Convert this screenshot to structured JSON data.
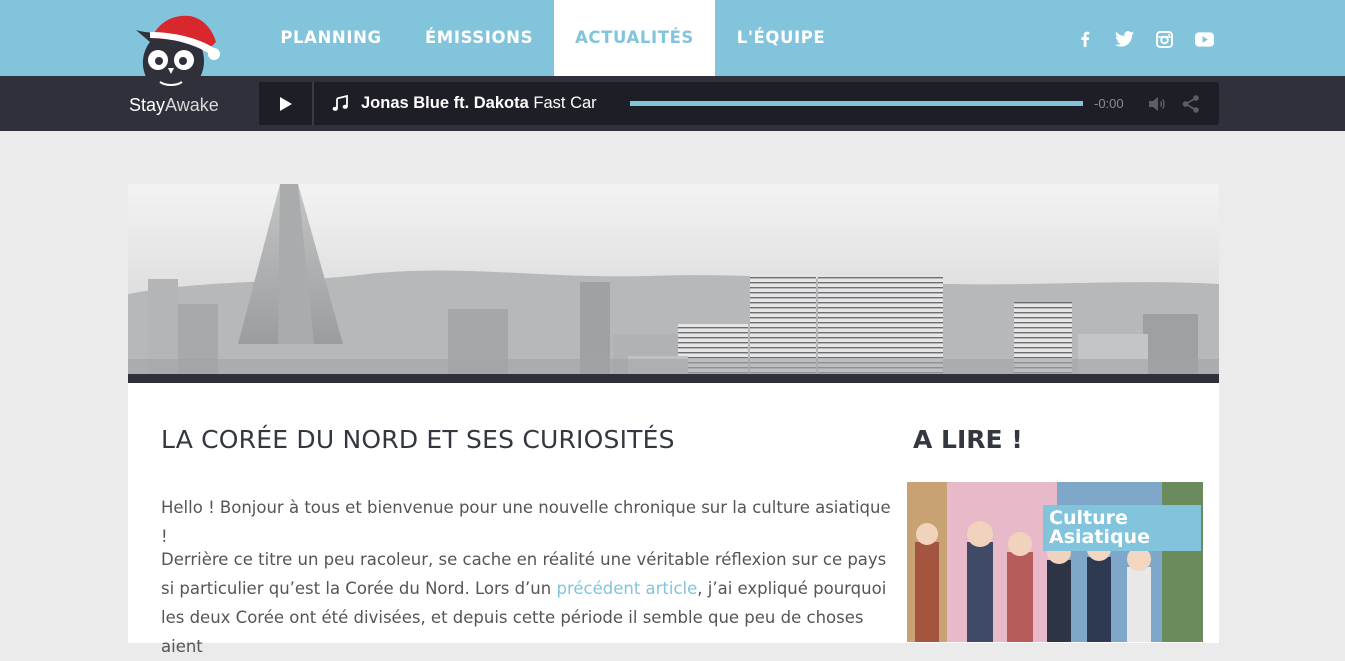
{
  "nav": {
    "items": [
      {
        "label": "PLANNING",
        "active": false
      },
      {
        "label": "ÉMISSIONS",
        "active": false
      },
      {
        "label": "ACTUALITÉS",
        "active": true
      },
      {
        "label": "L'ÉQUIPE",
        "active": false
      }
    ],
    "social": [
      "facebook-icon",
      "twitter-icon",
      "instagram-icon",
      "youtube-icon"
    ]
  },
  "logo": {
    "stay": "Stay",
    "awake": "Awake"
  },
  "player": {
    "artist": "Jonas Blue ft. Dakota",
    "title": "Fast Car",
    "time": "-0:00",
    "progress": 1.0
  },
  "article": {
    "title": "LA CORÉE DU NORD ET SES CURIOSITÉS",
    "p1": "Hello ! Bonjour à tous et bienvenue pour une nouvelle chronique sur la culture asiatique !",
    "p2_before": "Derrière ce titre un peu racoleur, se cache en réalité une véritable réflexion sur ce pays si particulier qu’est la Corée du Nord. Lors d’un ",
    "p2_link": "précédent article",
    "p2_after": ", j’ai expliqué pourquoi les deux Corée ont été divisées, et depuis cette période il semble que peu de choses aient"
  },
  "sidebar": {
    "title": "A LIRE !",
    "card_label": "Culture Asiatique"
  },
  "colors": {
    "accent": "#81c4db",
    "dark": "#2f3039"
  }
}
